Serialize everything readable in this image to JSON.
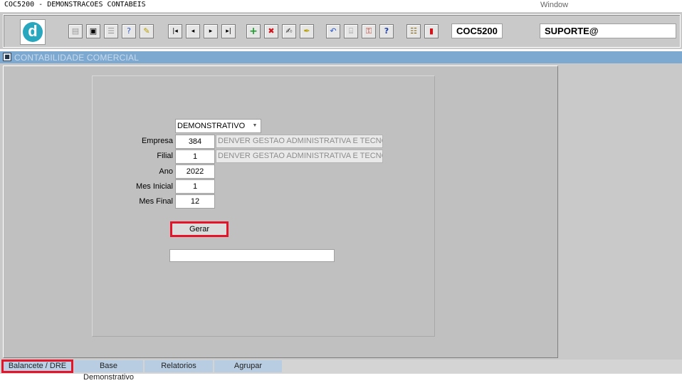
{
  "app": {
    "title": "COC5200 - DEMONSTRACOES CONTABEIS",
    "window_menu": "Window"
  },
  "toolbar": {
    "logo_letter": "d",
    "program_code": "COC5200",
    "user": "SUPORTE@",
    "icons": {
      "save": "▤",
      "window": "▣",
      "print": "☰",
      "query": "?",
      "query_exec": "✎",
      "first": "|◂",
      "prev": "◂",
      "next": "▸",
      "last": "▸|",
      "insert": "+",
      "delete": "✖",
      "edit": "✍",
      "clear": "✒",
      "undo": "↶",
      "copy": "⌸",
      "key": "⚿",
      "help": "?",
      "doc": "☷",
      "exit": "▮"
    }
  },
  "window": {
    "icon": "■",
    "title": "CONTABILIDADE COMERCIAL"
  },
  "form": {
    "report_type": "DEMONSTRATIVO",
    "empresa_label": "Empresa",
    "empresa_code": "384",
    "empresa_name": "DENVER GESTAO ADMINISTRATIVA E TECNOLOG",
    "filial_label": "Filial",
    "filial_code": "1",
    "filial_name": "DENVER GESTAO ADMINISTRATIVA E TECNOLOG",
    "ano_label": "Ano",
    "ano": "2022",
    "mes_inicial_label": "Mes Inicial",
    "mes_inicial": "1",
    "mes_final_label": "Mes Final",
    "mes_final": "12",
    "gerar_label": "Gerar",
    "status_value": ""
  },
  "tabs": [
    {
      "label": "Balancete / DRE",
      "active": true
    },
    {
      "label": "Base Demonstrativo",
      "active": false
    },
    {
      "label": "Relatorios",
      "active": false
    },
    {
      "label": "Agrupar",
      "active": false
    }
  ],
  "colors": {
    "highlight": "#e3152b",
    "caption": "#7da8cf",
    "tab": "#b9cde2"
  }
}
